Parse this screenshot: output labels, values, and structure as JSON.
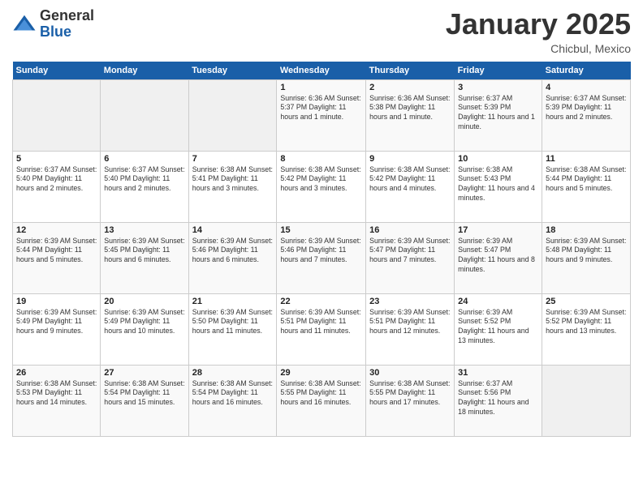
{
  "header": {
    "logo_line1": "General",
    "logo_line2": "Blue",
    "month": "January 2025",
    "location": "Chicbul, Mexico"
  },
  "days_of_week": [
    "Sunday",
    "Monday",
    "Tuesday",
    "Wednesday",
    "Thursday",
    "Friday",
    "Saturday"
  ],
  "weeks": [
    [
      {
        "day": "",
        "info": ""
      },
      {
        "day": "",
        "info": ""
      },
      {
        "day": "",
        "info": ""
      },
      {
        "day": "1",
        "info": "Sunrise: 6:36 AM\nSunset: 5:37 PM\nDaylight: 11 hours\nand 1 minute."
      },
      {
        "day": "2",
        "info": "Sunrise: 6:36 AM\nSunset: 5:38 PM\nDaylight: 11 hours\nand 1 minute."
      },
      {
        "day": "3",
        "info": "Sunrise: 6:37 AM\nSunset: 5:39 PM\nDaylight: 11 hours\nand 1 minute."
      },
      {
        "day": "4",
        "info": "Sunrise: 6:37 AM\nSunset: 5:39 PM\nDaylight: 11 hours\nand 2 minutes."
      }
    ],
    [
      {
        "day": "5",
        "info": "Sunrise: 6:37 AM\nSunset: 5:40 PM\nDaylight: 11 hours\nand 2 minutes."
      },
      {
        "day": "6",
        "info": "Sunrise: 6:37 AM\nSunset: 5:40 PM\nDaylight: 11 hours\nand 2 minutes."
      },
      {
        "day": "7",
        "info": "Sunrise: 6:38 AM\nSunset: 5:41 PM\nDaylight: 11 hours\nand 3 minutes."
      },
      {
        "day": "8",
        "info": "Sunrise: 6:38 AM\nSunset: 5:42 PM\nDaylight: 11 hours\nand 3 minutes."
      },
      {
        "day": "9",
        "info": "Sunrise: 6:38 AM\nSunset: 5:42 PM\nDaylight: 11 hours\nand 4 minutes."
      },
      {
        "day": "10",
        "info": "Sunrise: 6:38 AM\nSunset: 5:43 PM\nDaylight: 11 hours\nand 4 minutes."
      },
      {
        "day": "11",
        "info": "Sunrise: 6:38 AM\nSunset: 5:44 PM\nDaylight: 11 hours\nand 5 minutes."
      }
    ],
    [
      {
        "day": "12",
        "info": "Sunrise: 6:39 AM\nSunset: 5:44 PM\nDaylight: 11 hours\nand 5 minutes."
      },
      {
        "day": "13",
        "info": "Sunrise: 6:39 AM\nSunset: 5:45 PM\nDaylight: 11 hours\nand 6 minutes."
      },
      {
        "day": "14",
        "info": "Sunrise: 6:39 AM\nSunset: 5:46 PM\nDaylight: 11 hours\nand 6 minutes."
      },
      {
        "day": "15",
        "info": "Sunrise: 6:39 AM\nSunset: 5:46 PM\nDaylight: 11 hours\nand 7 minutes."
      },
      {
        "day": "16",
        "info": "Sunrise: 6:39 AM\nSunset: 5:47 PM\nDaylight: 11 hours\nand 7 minutes."
      },
      {
        "day": "17",
        "info": "Sunrise: 6:39 AM\nSunset: 5:47 PM\nDaylight: 11 hours\nand 8 minutes."
      },
      {
        "day": "18",
        "info": "Sunrise: 6:39 AM\nSunset: 5:48 PM\nDaylight: 11 hours\nand 9 minutes."
      }
    ],
    [
      {
        "day": "19",
        "info": "Sunrise: 6:39 AM\nSunset: 5:49 PM\nDaylight: 11 hours\nand 9 minutes."
      },
      {
        "day": "20",
        "info": "Sunrise: 6:39 AM\nSunset: 5:49 PM\nDaylight: 11 hours\nand 10 minutes."
      },
      {
        "day": "21",
        "info": "Sunrise: 6:39 AM\nSunset: 5:50 PM\nDaylight: 11 hours\nand 11 minutes."
      },
      {
        "day": "22",
        "info": "Sunrise: 6:39 AM\nSunset: 5:51 PM\nDaylight: 11 hours\nand 11 minutes."
      },
      {
        "day": "23",
        "info": "Sunrise: 6:39 AM\nSunset: 5:51 PM\nDaylight: 11 hours\nand 12 minutes."
      },
      {
        "day": "24",
        "info": "Sunrise: 6:39 AM\nSunset: 5:52 PM\nDaylight: 11 hours\nand 13 minutes."
      },
      {
        "day": "25",
        "info": "Sunrise: 6:39 AM\nSunset: 5:52 PM\nDaylight: 11 hours\nand 13 minutes."
      }
    ],
    [
      {
        "day": "26",
        "info": "Sunrise: 6:38 AM\nSunset: 5:53 PM\nDaylight: 11 hours\nand 14 minutes."
      },
      {
        "day": "27",
        "info": "Sunrise: 6:38 AM\nSunset: 5:54 PM\nDaylight: 11 hours\nand 15 minutes."
      },
      {
        "day": "28",
        "info": "Sunrise: 6:38 AM\nSunset: 5:54 PM\nDaylight: 11 hours\nand 16 minutes."
      },
      {
        "day": "29",
        "info": "Sunrise: 6:38 AM\nSunset: 5:55 PM\nDaylight: 11 hours\nand 16 minutes."
      },
      {
        "day": "30",
        "info": "Sunrise: 6:38 AM\nSunset: 5:55 PM\nDaylight: 11 hours\nand 17 minutes."
      },
      {
        "day": "31",
        "info": "Sunrise: 6:37 AM\nSunset: 5:56 PM\nDaylight: 11 hours\nand 18 minutes."
      },
      {
        "day": "",
        "info": ""
      }
    ]
  ]
}
